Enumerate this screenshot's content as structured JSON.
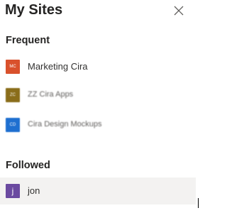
{
  "header": {
    "title": "My Sites",
    "close_icon": "close-icon"
  },
  "frequent": {
    "label": "Frequent",
    "items": [
      {
        "initials": "MC",
        "label": "Marketing Cira",
        "color": "#d9512c"
      },
      {
        "initials": "ZC",
        "label": "ZZ Cira Apps",
        "color": "#8a6d1a"
      },
      {
        "initials": "CD",
        "label": "Cira Design Mockups",
        "color": "#1e6fd0"
      }
    ]
  },
  "followed": {
    "label": "Followed",
    "items": [
      {
        "initials": "j",
        "label": "jon",
        "color": "#6b4aa0"
      }
    ]
  }
}
